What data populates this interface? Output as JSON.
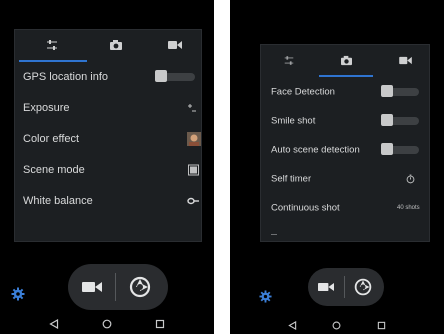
{
  "colors": {
    "accent": "#2f74d0",
    "panel": "#1c1f22",
    "background": "#000000"
  },
  "left_screen": {
    "tabs": [
      {
        "icon": "sliders-icon",
        "active": true
      },
      {
        "icon": "camera-icon",
        "active": false
      },
      {
        "icon": "video-icon",
        "active": false
      }
    ],
    "settings": [
      {
        "label": "GPS location info",
        "control": "toggle",
        "state": "off"
      },
      {
        "label": "Exposure",
        "control": "icon",
        "icon": "exposure-icon"
      },
      {
        "label": "Color effect",
        "control": "icon",
        "icon": "color-effect-thumbnail-icon"
      },
      {
        "label": "Scene mode",
        "control": "icon",
        "icon": "scene-mode-icon"
      },
      {
        "label": "White balance",
        "control": "icon",
        "icon": "white-balance-icon"
      }
    ]
  },
  "right_screen": {
    "tabs": [
      {
        "icon": "sliders-icon",
        "active": false
      },
      {
        "icon": "camera-icon",
        "active": true
      },
      {
        "icon": "video-icon",
        "active": false
      }
    ],
    "settings": [
      {
        "label": "Face Detection",
        "control": "toggle",
        "state": "off"
      },
      {
        "label": "Smile shot",
        "control": "toggle",
        "state": "off"
      },
      {
        "label": "Auto scene detection",
        "control": "toggle",
        "state": "off"
      },
      {
        "label": "Self timer",
        "control": "icon",
        "icon": "timer-icon"
      },
      {
        "label": "Continuous shot",
        "control": "text",
        "value": "40 shots"
      }
    ]
  },
  "bottom_controls": {
    "icons": [
      "video-mode-icon",
      "shutter-icon",
      "settings-gear-icon"
    ]
  },
  "navigation": {
    "icons": [
      "back-icon",
      "home-icon",
      "recents-icon"
    ]
  }
}
